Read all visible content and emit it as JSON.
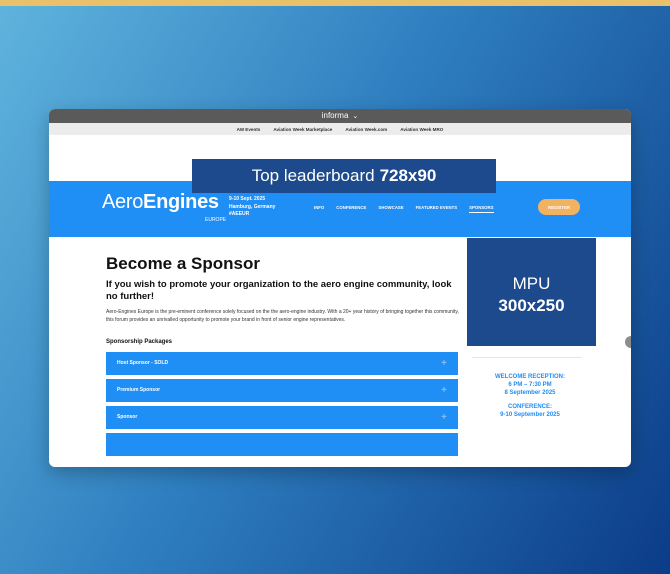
{
  "header": {
    "brand": "informa",
    "caret": "⌄",
    "links": [
      "AW Events",
      "Aviation Week Marketplace",
      "Aviation Week.com",
      "Aviation Week MRO"
    ]
  },
  "ads": {
    "leaderboard_text": "Top leaderboard",
    "leaderboard_size": "728x90",
    "mpu_text": "MPU",
    "mpu_size": "300x250"
  },
  "nav": {
    "logo_prefix": "Aero",
    "logo_bold": "Engines",
    "logo_tag": "AVIATION WEEK",
    "logo_sub": "EUROPE",
    "event_date": "9-10 Sept. 2025",
    "event_location": "Hamburg, Germany",
    "event_hashtag": "#AEEUR",
    "items": [
      "INFO",
      "CONFERENCE",
      "SHOWCASE",
      "FEATURED EVENTS",
      "SPONSORS"
    ],
    "register_label": "REGISTER"
  },
  "main": {
    "heading": "Become a Sponsor",
    "subheading": "If you wish to promote your organization to the aero engine community, look no further!",
    "paragraph": "Aero-Engines Europe is the pre-eminent conference solely focused on the the aero-engine industry. With a 20+ year history of bringing together this community, this forum provides an unrivalled opportunity to promote your brand in front of senior engine representatives.",
    "packages_title": "Sponsorship Packages",
    "packages": [
      "Host Sponsor - SOLD",
      "Premium Sponsor",
      "Sponsor"
    ],
    "plus_symbol": "+"
  },
  "sidebar": {
    "reception_title": "WELCOME RECEPTION:",
    "reception_time": "6 PM – 7:30 PM",
    "reception_date": "8 September 2025",
    "conference_title": "CONFERENCE:",
    "conference_dates": "9-10 September 2025"
  },
  "colors": {
    "nav_blue": "#1f8ef5",
    "ad_navy": "#1c4a8c",
    "register_orange": "#f3b25f",
    "accent_gold": "#e9c16b"
  }
}
